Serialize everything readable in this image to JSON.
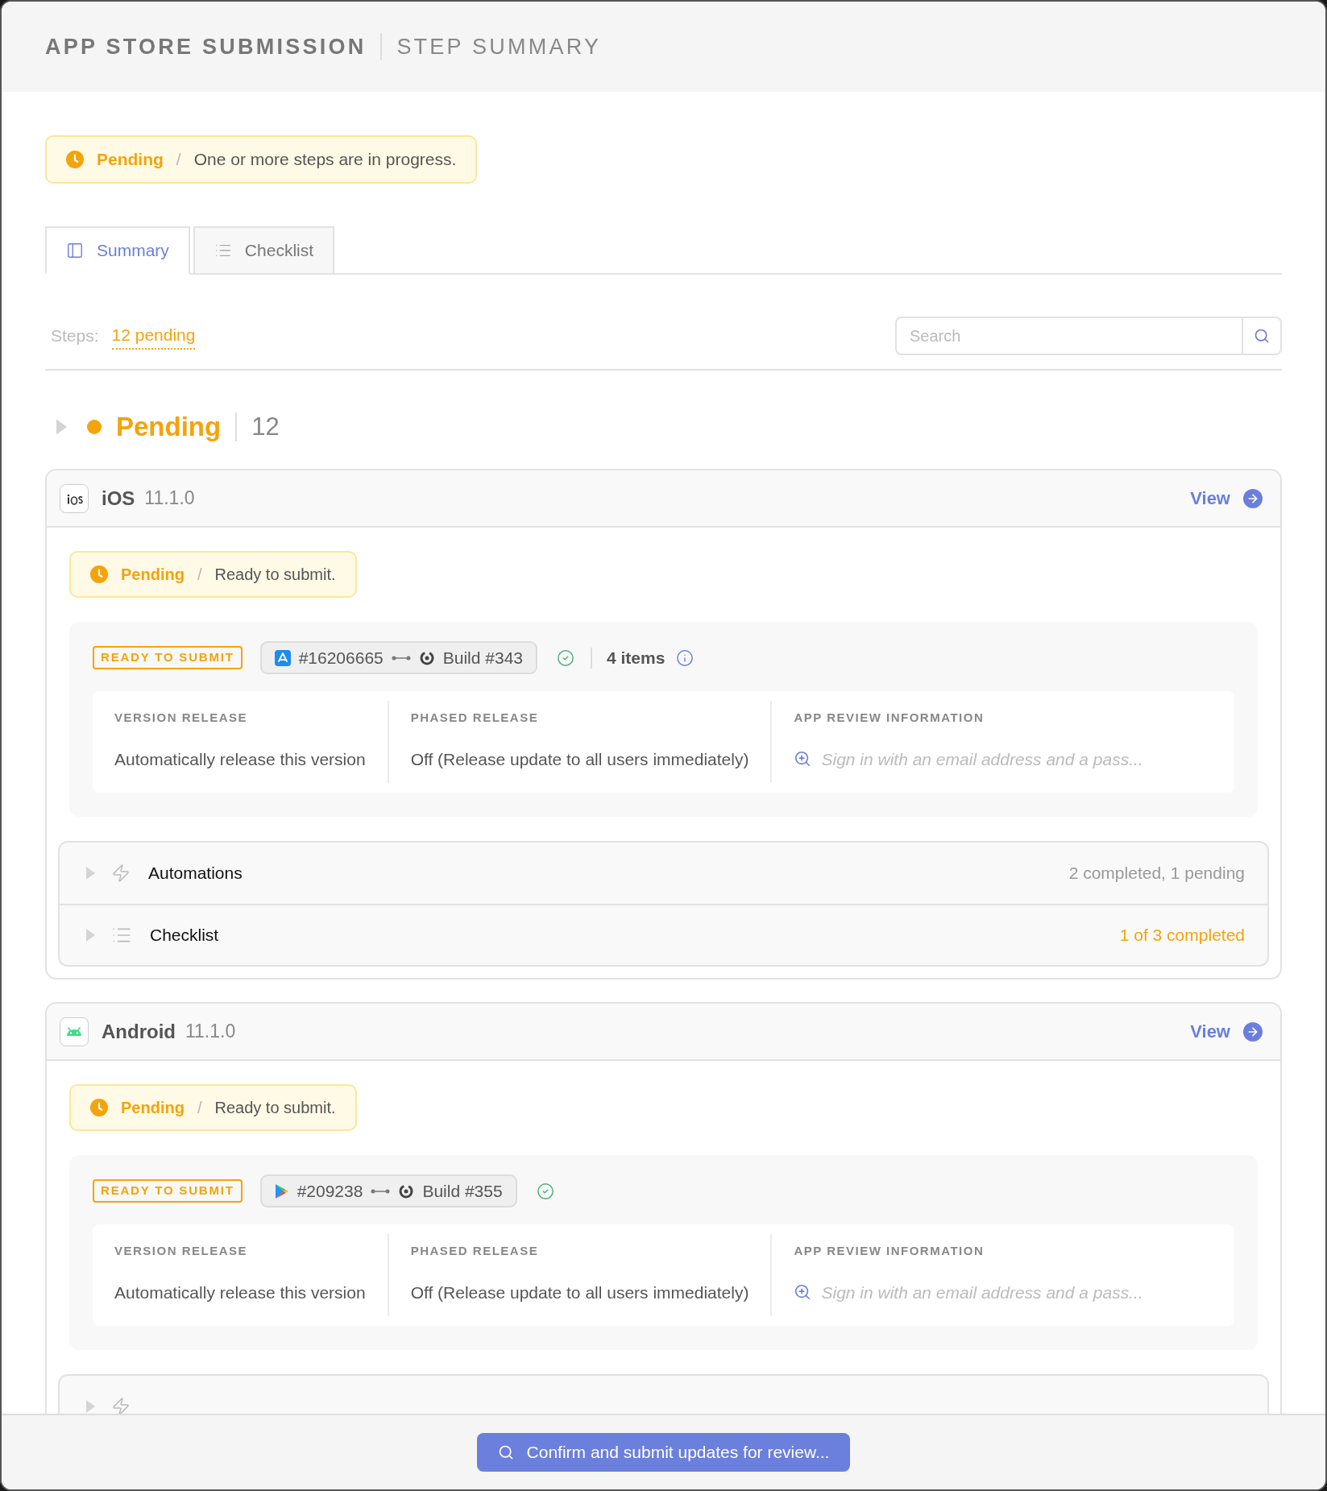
{
  "header": {
    "title": "APP STORE SUBMISSION",
    "subtitle": "STEP SUMMARY"
  },
  "status_banner": {
    "status": "Pending",
    "separator": "/",
    "message": "One or more steps are in progress."
  },
  "tabs": [
    {
      "label": "Summary",
      "kind": "summary",
      "selected": true
    },
    {
      "label": "Checklist",
      "kind": "checklist",
      "selected": false
    }
  ],
  "steps": {
    "label": "Steps:",
    "value": "12 pending"
  },
  "search": {
    "placeholder": "Search"
  },
  "group": {
    "label": "Pending",
    "count": "12",
    "expanded": false
  },
  "platforms": [
    {
      "kind": "ios",
      "name": "iOS",
      "version": "11.1.0",
      "view_label": "View",
      "status": {
        "status": "Pending",
        "separator": "/",
        "message": "Ready to submit."
      },
      "submission": {
        "badge": "READY TO SUBMIT",
        "kind": "appstore",
        "store_id": "#16206665",
        "build": "Build #343",
        "items": "4 items"
      },
      "fields": [
        {
          "label": "VERSION RELEASE",
          "value": "Automatically release this version",
          "kind": "text"
        },
        {
          "label": "PHASED RELEASE",
          "value": "Off (Release update to all users immediately)",
          "kind": "text"
        },
        {
          "label": "APP REVIEW INFORMATION",
          "value": "Sign in with an email address and a pass...",
          "kind": "placeholder"
        }
      ],
      "sections": [
        {
          "kind": "automations",
          "label": "Automations",
          "summary": "2 completed, 1 pending",
          "color": "#999999",
          "expanded": false
        },
        {
          "kind": "checklist",
          "label": "Checklist",
          "summary": "1 of 3 completed",
          "color": "#f5a30a",
          "expanded": false
        }
      ]
    },
    {
      "kind": "android",
      "name": "Android",
      "version": "11.1.0",
      "view_label": "View",
      "status": {
        "status": "Pending",
        "separator": "/",
        "message": "Ready to submit."
      },
      "submission": {
        "badge": "READY TO SUBMIT",
        "kind": "playstore",
        "store_id": "#209238",
        "build": "Build #355"
      },
      "fields": [
        {
          "label": "VERSION RELEASE",
          "value": "Automatically release this version",
          "kind": "text"
        },
        {
          "label": "PHASED RELEASE",
          "value": "Off (Release update to all users immediately)",
          "kind": "text"
        },
        {
          "label": "APP REVIEW INFORMATION",
          "value": "Sign in with an email address and a pass...",
          "kind": "placeholder"
        }
      ],
      "sections": [
        {
          "kind": "automations",
          "expanded": false
        }
      ]
    }
  ],
  "footer": {
    "button": "Confirm and submit updates for review..."
  }
}
